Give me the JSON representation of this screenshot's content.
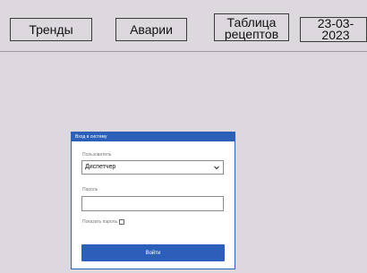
{
  "nav": {
    "trends_label": "Тренды",
    "alarms_label": "Аварии",
    "recipes_label": "Таблица рецептов",
    "date": "23-03-2023"
  },
  "login": {
    "title": "Вход в систему",
    "user_label": "Пользователь",
    "user_value": "Диспетчер",
    "password_label": "Пароль",
    "password_value": "",
    "show_password_label": "Показать пароль",
    "show_password_checked": false,
    "submit_label": "Войти"
  },
  "colors": {
    "background": "#dcd8de",
    "accent": "#2b5fb9"
  },
  "icons": {
    "dropdown": "chevron-down-icon"
  }
}
